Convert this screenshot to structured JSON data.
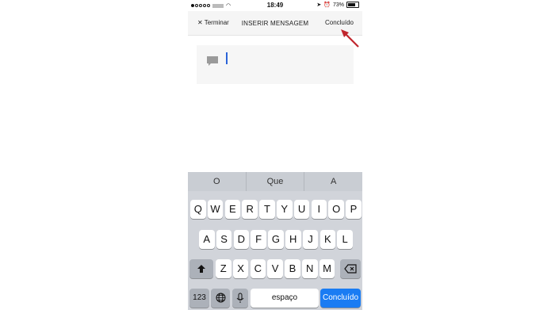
{
  "status_bar": {
    "time": "18:49",
    "battery": "73%",
    "battery_level": 0.73
  },
  "nav": {
    "end_label": "Terminar",
    "title": "INSERIR MENSAGEM",
    "done_label": "Concluído"
  },
  "compose": {
    "value": ""
  },
  "keyboard": {
    "suggestions": [
      "O",
      "Que",
      "A"
    ],
    "rows": [
      [
        "Q",
        "W",
        "E",
        "R",
        "T",
        "Y",
        "U",
        "I",
        "O",
        "P"
      ],
      [
        "A",
        "S",
        "D",
        "F",
        "G",
        "H",
        "J",
        "K",
        "L"
      ],
      [
        "Z",
        "X",
        "C",
        "V",
        "B",
        "N",
        "M"
      ]
    ],
    "numbers_key": "123",
    "space_key": "espaço",
    "return_key": "Concluído"
  },
  "colors": {
    "annotation_arrow": "#c0262d",
    "return_key": "#1a7cf3",
    "cursor": "#2b63d8"
  }
}
